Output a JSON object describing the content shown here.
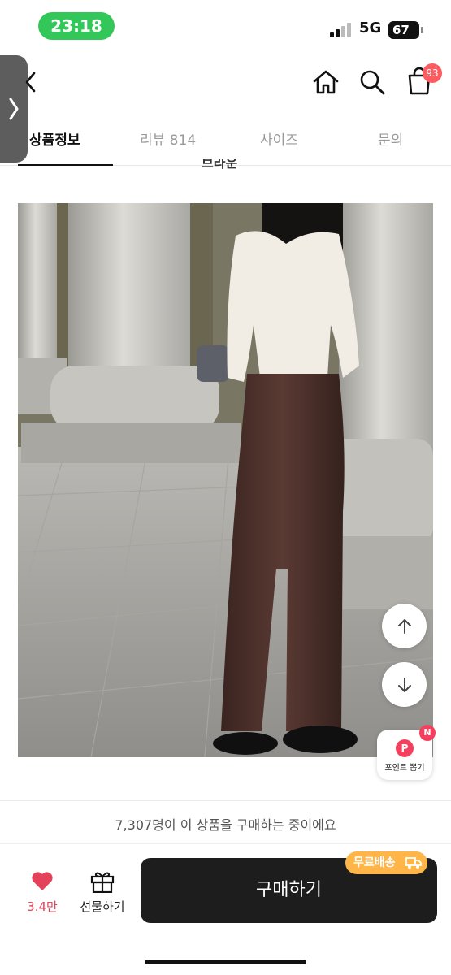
{
  "status_bar": {
    "time": "23:18",
    "network": "5G",
    "battery": "67"
  },
  "header": {
    "cart_badge": "93",
    "icons": [
      "back-icon",
      "home-icon",
      "search-icon",
      "shopping-bag-icon"
    ]
  },
  "tabs": [
    {
      "label": "상품정보",
      "active": true
    },
    {
      "label": "리뷰 814",
      "active": false
    },
    {
      "label": "사이즈",
      "active": false
    },
    {
      "label": "문의",
      "active": false
    }
  ],
  "content": {
    "partial_heading": "브라운"
  },
  "floating": {
    "point_badge": "P",
    "point_notification": "N",
    "point_label": "포인트 뽑기"
  },
  "bottom_bar": {
    "buyers_notice": "7,307명이 이 상품을 구매하는 중이에요",
    "like_count": "3.4만",
    "gift_label": "선물하기",
    "buy_label": "구매하기",
    "shipping_badge": "무료배송"
  },
  "colors": {
    "accent_pink": "#e3425a",
    "status_green": "#33c75a",
    "shipping_orange": "#ffb547",
    "buy_button": "#1d1d1d"
  }
}
